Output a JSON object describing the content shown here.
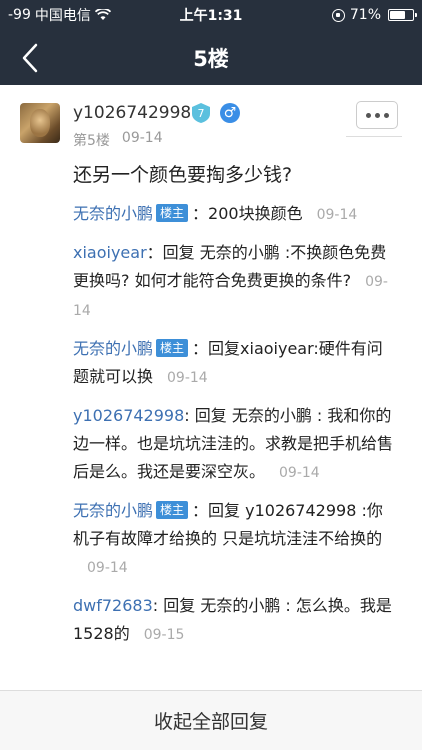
{
  "status": {
    "signal": "-99",
    "carrier": "中国电信",
    "time": "上午1:31",
    "battery": "71%",
    "battery_level": 0.71
  },
  "nav": {
    "title": "5楼"
  },
  "post": {
    "username": "y1026742998",
    "level": "7",
    "gender_symbol": "♂",
    "floor": "第5楼",
    "date": "09-14",
    "content": "还另一个颜色要掏多少钱?"
  },
  "replies": [
    {
      "name": "无奈的小鹏",
      "tag": "楼主",
      "text": "：200块换颜色",
      "date": "09-14"
    },
    {
      "name": "xiaoiyear",
      "tag": "",
      "text": "：回复 无奈的小鹏 :不换颜色免费更换吗? 如何才能符合免费更换的条件?",
      "date": "09-14"
    },
    {
      "name": "无奈的小鹏",
      "tag": "楼主",
      "text": "：回复xiaoiyear:硬件有问题就可以换",
      "date": "09-14"
    },
    {
      "name": "y1026742998",
      "tag": "",
      "text": ": 回复 无奈的小鹏 : 我和你的边一样。也是坑坑洼洼的。求教是把手机给售后是么。我还是要深空灰。",
      "date": "09-14"
    },
    {
      "name": "无奈的小鹏",
      "tag": "楼主",
      "text": "：回复 y1026742998 :你机子有故障才给换的 只是坑坑洼洼不给换的",
      "date": "09-14"
    },
    {
      "name": "dwf72683",
      "tag": "",
      "text": ": 回复 无奈的小鹏 : 怎么换。我是1528的",
      "date": "09-15"
    }
  ],
  "footer": {
    "collapse_label": "收起全部回复"
  },
  "colors": {
    "nav_bg": "#27303d",
    "link": "#3d70b2",
    "tag_bg": "#3d8fd8"
  }
}
